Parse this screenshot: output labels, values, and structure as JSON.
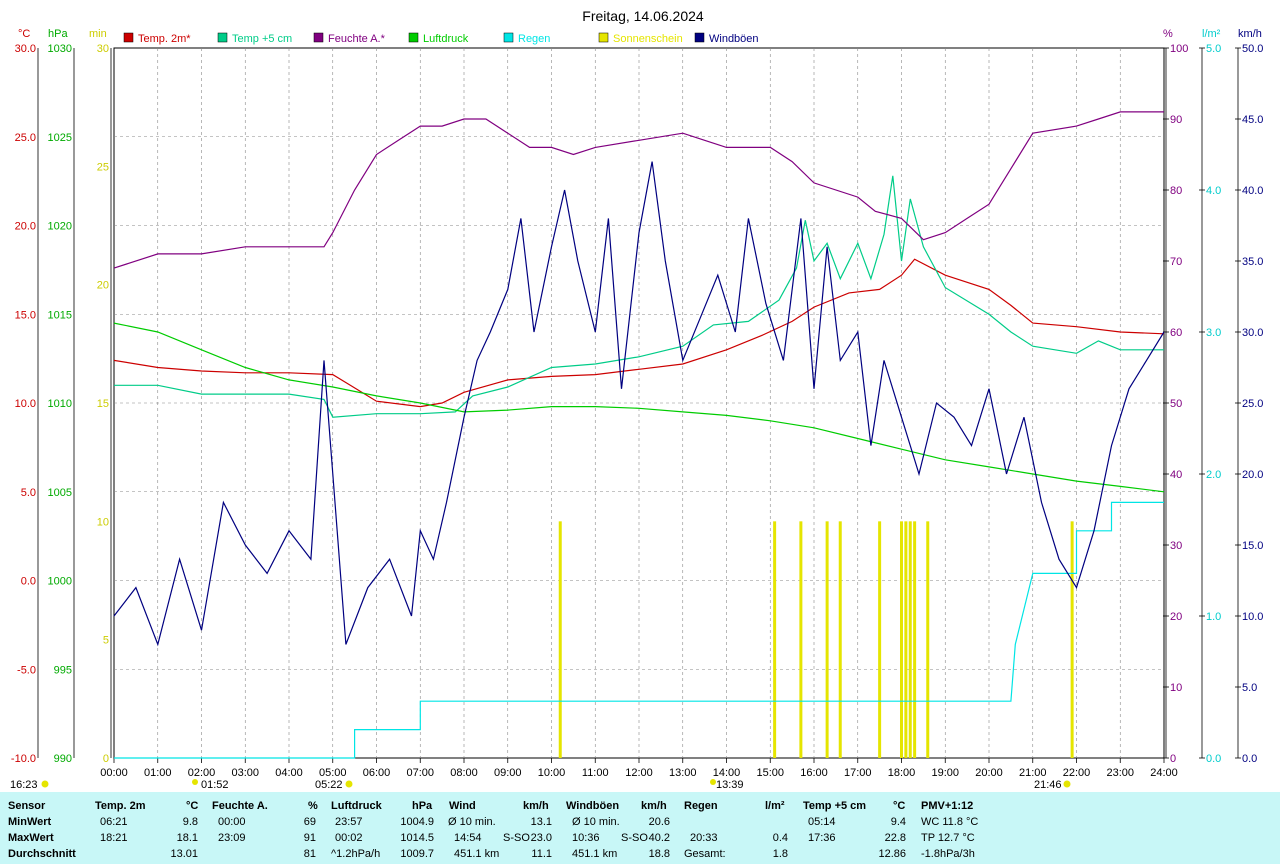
{
  "title": "Freitag, 14.06.2024",
  "axis_units": {
    "temp": "°C",
    "pressure": "hPa",
    "sun": "min",
    "humidity": "%",
    "rain": "l/m²",
    "wind": "km/h"
  },
  "legend": [
    {
      "label": "Temp. 2m*",
      "color": "#cc0000"
    },
    {
      "label": "Temp +5 cm",
      "color": "#00cc88"
    },
    {
      "label": "Feuchte A.*",
      "color": "#800080"
    },
    {
      "label": "Luftdruck",
      "color": "#00cc00"
    },
    {
      "label": "Regen",
      "color": "#00e5e5"
    },
    {
      "label": "Sonnenschein",
      "color": "#e5e500"
    },
    {
      "label": "Windböen",
      "color": "#000080"
    }
  ],
  "sun_markers": {
    "rise_top": "16:23",
    "sunrise": "01:52",
    "sunset_left": "05:22",
    "noon": "13:39",
    "moon": "21:46"
  },
  "chart_data": {
    "type": "line",
    "title": "Freitag, 14.06.2024",
    "x_ticks": [
      "00:00",
      "01:00",
      "02:00",
      "03:00",
      "04:00",
      "05:00",
      "06:00",
      "07:00",
      "08:00",
      "09:00",
      "10:00",
      "11:00",
      "12:00",
      "13:00",
      "14:00",
      "15:00",
      "16:00",
      "17:00",
      "18:00",
      "19:00",
      "20:00",
      "21:00",
      "22:00",
      "23:00",
      "24:00"
    ],
    "y_axes": [
      {
        "name": "temp",
        "unit": "°C",
        "range": [
          -10,
          30
        ],
        "ticks": [
          "30.0",
          "25.0",
          "20.0",
          "15.0",
          "10.0",
          "5.0",
          "0.0",
          "-5.0",
          "-10.0"
        ]
      },
      {
        "name": "pressure",
        "unit": "hPa",
        "range": [
          990,
          1030
        ],
        "ticks": [
          "1030",
          "1025",
          "1020",
          "1015",
          "1010",
          "1005",
          "1000",
          "995",
          "990"
        ]
      },
      {
        "name": "sun",
        "unit": "min",
        "range": [
          0,
          30
        ],
        "ticks": [
          "30",
          "25",
          "20",
          "15",
          "10",
          "5",
          "0"
        ]
      },
      {
        "name": "humidity",
        "unit": "%",
        "range": [
          0,
          100
        ],
        "ticks": [
          "100",
          "90",
          "80",
          "70",
          "60",
          "50",
          "40",
          "30",
          "20",
          "10",
          "0"
        ]
      },
      {
        "name": "rain",
        "unit": "l/m²",
        "range": [
          0,
          5
        ],
        "ticks": [
          "5.0",
          "4.0",
          "3.0",
          "2.0",
          "1.0",
          "0.0"
        ]
      },
      {
        "name": "wind",
        "unit": "km/h",
        "range": [
          0,
          50
        ],
        "ticks": [
          "50.0",
          "45.0",
          "40.0",
          "35.0",
          "30.0",
          "25.0",
          "20.0",
          "15.0",
          "10.0",
          "5.0",
          "0.0"
        ]
      }
    ],
    "series": [
      {
        "name": "Temp. 2m*",
        "axis": "temp",
        "color": "#cc0000",
        "points": [
          [
            0,
            12.4
          ],
          [
            1,
            12.0
          ],
          [
            2,
            11.8
          ],
          [
            3,
            11.7
          ],
          [
            4,
            11.7
          ],
          [
            5,
            11.6
          ],
          [
            6,
            10.1
          ],
          [
            7,
            9.8
          ],
          [
            7.5,
            10.0
          ],
          [
            8,
            10.6
          ],
          [
            9,
            11.3
          ],
          [
            10,
            11.5
          ],
          [
            11,
            11.6
          ],
          [
            12,
            11.9
          ],
          [
            13,
            12.2
          ],
          [
            14,
            13.0
          ],
          [
            14.8,
            13.8
          ],
          [
            15.5,
            14.6
          ],
          [
            16,
            15.4
          ],
          [
            16.8,
            16.2
          ],
          [
            17.5,
            16.4
          ],
          [
            18,
            17.2
          ],
          [
            18.3,
            18.1
          ],
          [
            19,
            17.2
          ],
          [
            20,
            16.4
          ],
          [
            20.5,
            15.5
          ],
          [
            21,
            14.5
          ],
          [
            22,
            14.3
          ],
          [
            23,
            14.0
          ],
          [
            24,
            13.9
          ]
        ]
      },
      {
        "name": "Temp +5 cm",
        "axis": "temp",
        "color": "#00cc88",
        "points": [
          [
            0,
            11.0
          ],
          [
            0.5,
            11.0
          ],
          [
            1,
            11.0
          ],
          [
            2,
            10.5
          ],
          [
            4,
            10.5
          ],
          [
            4.8,
            10.2
          ],
          [
            5,
            9.2
          ],
          [
            6,
            9.4
          ],
          [
            7,
            9.4
          ],
          [
            7.8,
            9.5
          ],
          [
            8.2,
            10.4
          ],
          [
            9,
            10.9
          ],
          [
            10,
            12.0
          ],
          [
            11,
            12.2
          ],
          [
            12,
            12.6
          ],
          [
            13,
            13.2
          ],
          [
            13.7,
            14.4
          ],
          [
            14.5,
            14.6
          ],
          [
            15.2,
            15.8
          ],
          [
            15.6,
            17.6
          ],
          [
            15.8,
            20.3
          ],
          [
            16,
            18.0
          ],
          [
            16.3,
            19.0
          ],
          [
            16.6,
            17.0
          ],
          [
            17,
            19.0
          ],
          [
            17.3,
            17.0
          ],
          [
            17.6,
            19.5
          ],
          [
            17.8,
            22.8
          ],
          [
            18,
            18.0
          ],
          [
            18.2,
            21.5
          ],
          [
            18.5,
            18.8
          ],
          [
            19,
            16.5
          ],
          [
            20,
            15.0
          ],
          [
            20.5,
            14.0
          ],
          [
            21,
            13.2
          ],
          [
            22,
            12.8
          ],
          [
            22.5,
            13.5
          ],
          [
            23,
            13.0
          ],
          [
            24,
            13.0
          ]
        ]
      },
      {
        "name": "Feuchte A.*",
        "axis": "humidity",
        "color": "#800080",
        "points": [
          [
            0,
            69
          ],
          [
            1,
            71
          ],
          [
            2,
            71
          ],
          [
            3,
            72
          ],
          [
            4,
            72
          ],
          [
            4.8,
            72
          ],
          [
            5,
            74
          ],
          [
            5.5,
            80
          ],
          [
            6,
            85
          ],
          [
            6.5,
            87
          ],
          [
            7,
            89
          ],
          [
            7.5,
            89
          ],
          [
            8,
            90
          ],
          [
            8.5,
            90
          ],
          [
            9,
            88
          ],
          [
            9.5,
            86
          ],
          [
            10,
            86
          ],
          [
            10.5,
            85
          ],
          [
            11,
            86
          ],
          [
            12,
            87
          ],
          [
            13,
            88
          ],
          [
            13.5,
            87
          ],
          [
            14,
            86
          ],
          [
            15,
            86
          ],
          [
            15.5,
            84
          ],
          [
            16,
            81
          ],
          [
            17,
            79
          ],
          [
            17.4,
            77
          ],
          [
            18,
            76
          ],
          [
            18.5,
            73
          ],
          [
            19,
            74
          ],
          [
            19.5,
            76
          ],
          [
            20,
            78
          ],
          [
            20.5,
            83
          ],
          [
            21,
            88
          ],
          [
            22,
            89
          ],
          [
            22.5,
            90
          ],
          [
            23,
            91
          ],
          [
            24,
            91
          ]
        ]
      },
      {
        "name": "Luftdruck",
        "axis": "pressure",
        "color": "#00cc00",
        "points": [
          [
            0,
            1014.5
          ],
          [
            1,
            1014.0
          ],
          [
            2,
            1013.0
          ],
          [
            3,
            1012.0
          ],
          [
            4,
            1011.3
          ],
          [
            5,
            1010.9
          ],
          [
            6,
            1010.4
          ],
          [
            7,
            1010.0
          ],
          [
            8,
            1009.5
          ],
          [
            9,
            1009.6
          ],
          [
            10,
            1009.8
          ],
          [
            11,
            1009.8
          ],
          [
            12,
            1009.7
          ],
          [
            13,
            1009.5
          ],
          [
            14,
            1009.3
          ],
          [
            15,
            1009.0
          ],
          [
            16,
            1008.6
          ],
          [
            17,
            1008.0
          ],
          [
            18,
            1007.4
          ],
          [
            19,
            1006.8
          ],
          [
            20,
            1006.4
          ],
          [
            21,
            1006.0
          ],
          [
            22,
            1005.6
          ],
          [
            23,
            1005.3
          ],
          [
            24,
            1005.0
          ]
        ]
      },
      {
        "name": "Regen",
        "axis": "rain",
        "color": "#00e5e5",
        "points": [
          [
            0,
            0
          ],
          [
            5.5,
            0
          ],
          [
            5.5,
            0.2
          ],
          [
            7,
            0.2
          ],
          [
            7,
            0.4
          ],
          [
            20.5,
            0.4
          ],
          [
            20.6,
            0.8
          ],
          [
            21,
            1.3
          ],
          [
            22,
            1.3
          ],
          [
            22,
            1.6
          ],
          [
            22.8,
            1.6
          ],
          [
            22.8,
            1.8
          ],
          [
            24,
            1.8
          ]
        ]
      },
      {
        "name": "Windböen",
        "axis": "wind",
        "color": "#000080",
        "points": [
          [
            0,
            10
          ],
          [
            0.5,
            12
          ],
          [
            1,
            8
          ],
          [
            1.5,
            14
          ],
          [
            2,
            9
          ],
          [
            2.5,
            18
          ],
          [
            3,
            15
          ],
          [
            3.5,
            13
          ],
          [
            4,
            16
          ],
          [
            4.5,
            14
          ],
          [
            4.8,
            28
          ],
          [
            5,
            20
          ],
          [
            5.3,
            8
          ],
          [
            5.8,
            12
          ],
          [
            6.3,
            14
          ],
          [
            6.8,
            10
          ],
          [
            7,
            16
          ],
          [
            7.3,
            14
          ],
          [
            7.6,
            18
          ],
          [
            8,
            24
          ],
          [
            8.3,
            28
          ],
          [
            8.6,
            30
          ],
          [
            9,
            33
          ],
          [
            9.3,
            38
          ],
          [
            9.6,
            30
          ],
          [
            10,
            36
          ],
          [
            10.3,
            40
          ],
          [
            10.6,
            35
          ],
          [
            11,
            30
          ],
          [
            11.3,
            38
          ],
          [
            11.6,
            26
          ],
          [
            12,
            37
          ],
          [
            12.3,
            42
          ],
          [
            12.6,
            35
          ],
          [
            13,
            28
          ],
          [
            13.4,
            31
          ],
          [
            13.8,
            34
          ],
          [
            14.2,
            30
          ],
          [
            14.5,
            38
          ],
          [
            14.9,
            32
          ],
          [
            15.3,
            28
          ],
          [
            15.7,
            38
          ],
          [
            16,
            26
          ],
          [
            16.3,
            36
          ],
          [
            16.6,
            28
          ],
          [
            17,
            30
          ],
          [
            17.3,
            22
          ],
          [
            17.6,
            28
          ],
          [
            18,
            24
          ],
          [
            18.4,
            20
          ],
          [
            18.8,
            25
          ],
          [
            19.2,
            24
          ],
          [
            19.6,
            22
          ],
          [
            20,
            26
          ],
          [
            20.4,
            20
          ],
          [
            20.8,
            24
          ],
          [
            21.2,
            18
          ],
          [
            21.6,
            14
          ],
          [
            22,
            12
          ],
          [
            22.4,
            16
          ],
          [
            22.8,
            22
          ],
          [
            23.2,
            26
          ],
          [
            23.6,
            28
          ],
          [
            24,
            30
          ]
        ]
      }
    ],
    "sunshine_bars": [
      10.2,
      15.1,
      15.7,
      16.3,
      16.6,
      17.5,
      18.0,
      18.1,
      18.2,
      18.3,
      18.6,
      21.9
    ],
    "grid": true
  },
  "stats": {
    "headers": {
      "sensor": "Sensor",
      "temp": "Temp. 2m",
      "temp_u": "°C",
      "hum": "Feuchte A.",
      "hum_u": "%",
      "press": "Luftdruck",
      "press_u": "hPa",
      "wind": "Wind",
      "wind_u": "km/h",
      "gust": "Windböen",
      "gust_u": "km/h",
      "rain": "Regen",
      "rain_u": "l/m²",
      "t5": "Temp +5 cm",
      "t5_u": "°C",
      "pmv": "PMV+1:12"
    },
    "rows": [
      {
        "label": "MinWert",
        "temp_t": "06:21",
        "temp_v": "9.8",
        "hum_t": "00:00",
        "hum_v": "69",
        "press_t": "23:57",
        "press_v": "1004.9",
        "wind_t": "Ø 10 min.",
        "wind_d": "",
        "wind_v": "13.1",
        "gust_t": "Ø 10 min.",
        "gust_d": "",
        "gust_v": "20.6",
        "rain_t": "",
        "rain_v": "",
        "t5_t": "05:14",
        "t5_v": "9.4",
        "pmv": "WC 11.8 °C"
      },
      {
        "label": "MaxWert",
        "temp_t": "18:21",
        "temp_v": "18.1",
        "hum_t": "23:09",
        "hum_v": "91",
        "press_t": "00:02",
        "press_v": "1014.5",
        "wind_t": "14:54",
        "wind_d": "S-SO",
        "wind_v": "23.0",
        "gust_t": "10:36",
        "gust_d": "S-SO",
        "gust_v": "40.2",
        "rain_t": "20:33",
        "rain_v": "0.4",
        "t5_t": "17:36",
        "t5_v": "22.8",
        "pmv": "TP 12.7 °C"
      },
      {
        "label": "Durchschnitt",
        "temp_t": "",
        "temp_v": "13.01",
        "hum_t": "",
        "hum_v": "81",
        "press_t": "^1.2hPa/h",
        "press_v": "1009.7",
        "wind_t": "451.1 km",
        "wind_d": "",
        "wind_v": "11.1",
        "gust_t": "451.1 km",
        "gust_d": "",
        "gust_v": "18.8",
        "rain_t": "Gesamt:",
        "rain_v": "1.8",
        "t5_t": "",
        "t5_v": "12.86",
        "pmv": "-1.8hPa/3h"
      }
    ]
  }
}
